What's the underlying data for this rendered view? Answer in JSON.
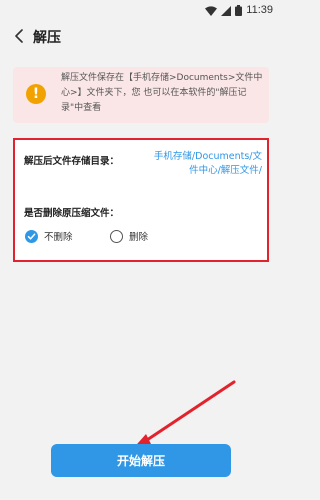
{
  "status_bar": {
    "time": "11:39",
    "icons": [
      "wifi-icon",
      "signal-icon",
      "battery-icon"
    ]
  },
  "header": {
    "back_icon": "chevron-left-icon",
    "title": "解压"
  },
  "notice": {
    "icon": "warning-icon",
    "icon_glyph": "!",
    "text": "解压文件保存在【手机存储>Documents>文件中心>】文件夹下，您 也可以在本软件的\"解压记录\"中查看"
  },
  "settings": {
    "directory_label": "解压后文件存储目录：",
    "directory_path": "手机存储/Documents/文件中心/解压文件/",
    "delete_label": "是否删除原压缩文件：",
    "options": [
      {
        "label": "不删除",
        "selected": true
      },
      {
        "label": "删除",
        "selected": false
      }
    ]
  },
  "start_button": {
    "label": "开始解压"
  },
  "colors": {
    "accent": "#2f97e6",
    "highlight_border": "#e2222c",
    "warning": "#f2a200",
    "notice_bg": "#fae6e6"
  }
}
